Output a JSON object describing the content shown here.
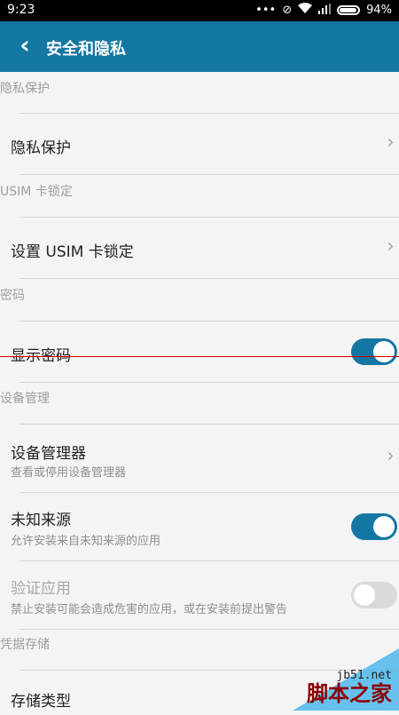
{
  "status_bar": {
    "time": "9:23",
    "battery_text": "94%",
    "icons": [
      "more-icon",
      "mute-icon",
      "wifi-icon",
      "signal-icon",
      "battery-icon"
    ]
  },
  "app_bar": {
    "title": "安全和隐私",
    "back_icon": "back-arrow-icon",
    "color": "#1477a3"
  },
  "sections": {
    "privacy": {
      "header": "隐私保护",
      "item_label": "隐私保护"
    },
    "usim": {
      "header": "USIM 卡锁定",
      "item_label": "设置 USIM 卡锁定"
    },
    "password": {
      "header": "密码",
      "item_label": "显示密码",
      "enabled": true
    },
    "device_mgmt": {
      "header": "设备管理",
      "device_admin": {
        "label": "设备管理器",
        "sub": "查看或停用设备管理器"
      },
      "unknown_sources": {
        "label": "未知来源",
        "sub": "允许安装来自未知来源的应用",
        "enabled": true
      },
      "verify_apps": {
        "label": "验证应用",
        "sub": "禁止安装可能会造成危害的应用，或在安装前提出警告",
        "enabled": false
      }
    },
    "credentials": {
      "header": "凭据存储",
      "storage_type_label": "存储类型"
    }
  },
  "watermark": {
    "url": "jb51.net",
    "brand": "脚本之家"
  }
}
